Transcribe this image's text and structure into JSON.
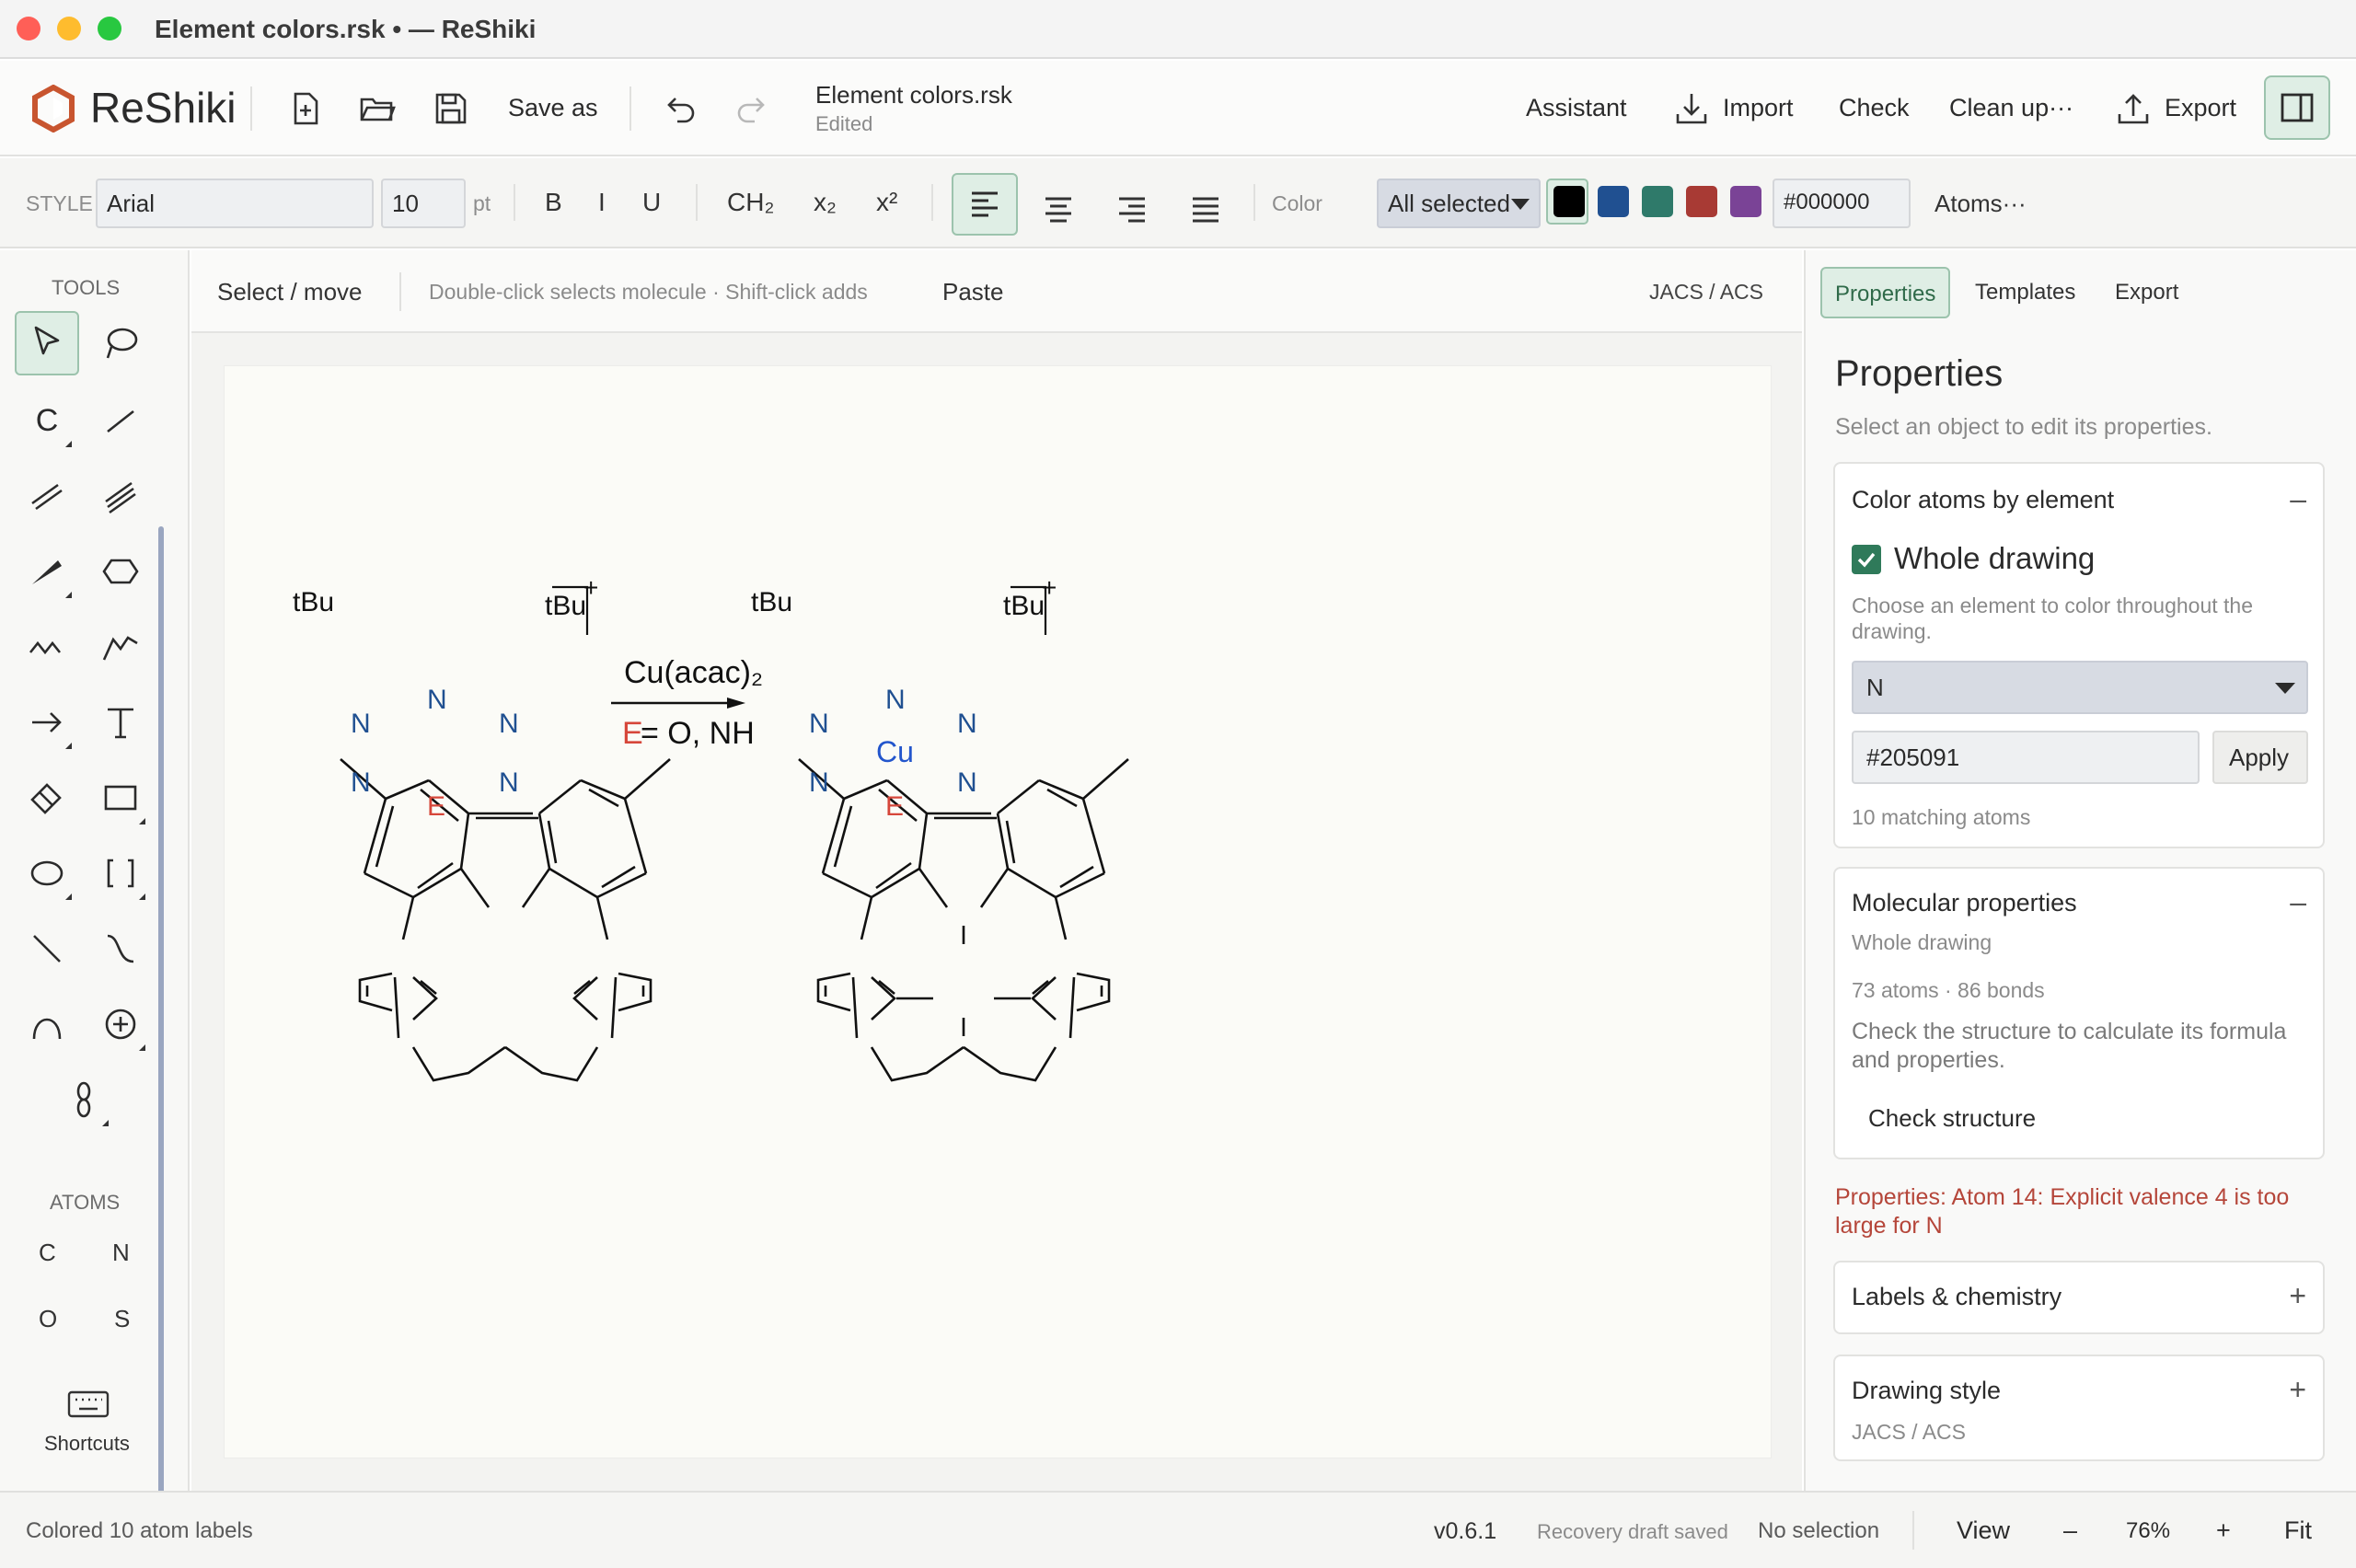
{
  "window": {
    "title": "Element colors.rsk • — ReShiki"
  },
  "header": {
    "brand": "ReShiki",
    "save_as": "Save as",
    "doc_name": "Element colors.rsk",
    "doc_state": "Edited",
    "assistant": "Assistant",
    "import": "Import",
    "check": "Check",
    "clean_up": "Clean up···",
    "export": "Export"
  },
  "style_bar": {
    "style_label": "STYLE",
    "font": "Arial",
    "size": "10",
    "unit": "pt",
    "bold": "B",
    "italic": "I",
    "underline": "U",
    "ch2": "CH₂",
    "subscript": "x₂",
    "superscript": "x²",
    "color_label": "Color",
    "color_scope": "All selected",
    "swatches": [
      "#000000",
      "#205091",
      "#2f7a6a",
      "#a83a34",
      "#7a4396"
    ],
    "hex": "#000000",
    "atoms_menu": "Atoms···"
  },
  "left_rail": {
    "tools_label": "TOOLS",
    "atoms_label": "ATOMS",
    "atoms": [
      "C",
      "N",
      "O",
      "S"
    ],
    "shortcuts": "Shortcuts",
    "carbon_tool": "C"
  },
  "canvas": {
    "mode": "Select / move",
    "hint": "Double-click selects molecule · Shift-click adds",
    "paste": "Paste",
    "style_preset": "JACS / ACS",
    "scheme": {
      "tbu": "tBu",
      "plus": "+",
      "n": "N",
      "e": "E",
      "cu": "Cu",
      "reagent": "Cu(acac)₂",
      "condition_e": "E",
      "condition_rest": " = O, NH"
    },
    "colors": {
      "nitrogen": "#205091",
      "heteroatom_e": "#d6463a",
      "copper": "#2255cc"
    }
  },
  "right_panel": {
    "tabs": [
      "Properties",
      "Templates",
      "Export"
    ],
    "title": "Properties",
    "subtitle": "Select an object to edit its properties.",
    "color_by_element": {
      "title": "Color atoms by element",
      "toggle": "–",
      "whole_drawing": "Whole drawing",
      "help": "Choose an element to color throughout the drawing.",
      "element": "N",
      "hex": "#205091",
      "apply": "Apply",
      "matches": "10 matching atoms"
    },
    "molecular": {
      "title": "Molecular properties",
      "toggle": "–",
      "scope": "Whole drawing",
      "counts": "73 atoms · 86 bonds",
      "help": "Check the structure to calculate its formula and properties.",
      "action": "Check structure"
    },
    "error": "Properties: Atom 14: Explicit valence 4 is too large for N",
    "labels": {
      "title": "Labels & chemistry",
      "toggle": "+"
    },
    "drawing_style": {
      "title": "Drawing style",
      "toggle": "+",
      "value": "JACS / ACS"
    }
  },
  "status": {
    "message": "Colored 10 atom labels",
    "version": "v0.6.1",
    "recovery": "Recovery draft saved",
    "selection": "No selection",
    "view": "View",
    "zoom_out": "–",
    "zoom": "76%",
    "zoom_in": "+",
    "fit": "Fit"
  }
}
